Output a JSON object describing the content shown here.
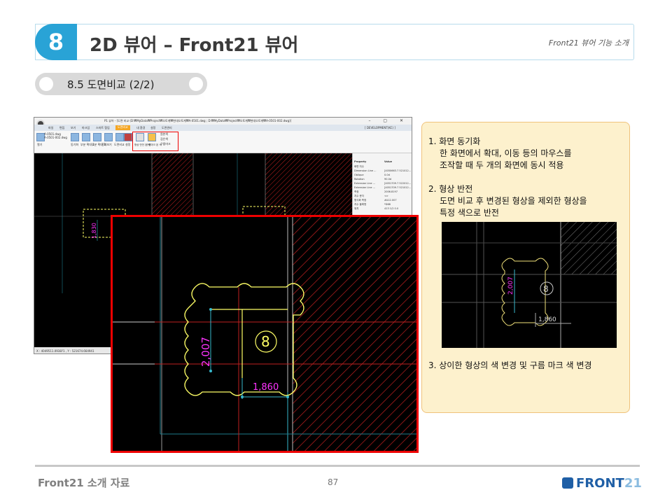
{
  "header": {
    "number": "8",
    "title": "2D 뷰어 – Front21 뷰어",
    "subtitle": "Front21 뷰어 기능 소개"
  },
  "section": {
    "title": "8.5 도면비교 (2/2)"
  },
  "app": {
    "window_title": "P1 뷰어 - [도면 비교 (D:₩MyData₩Project₩오토계₩현대오토계₩A-0501.dwg ; D:₩MyData₩Project₩오토계₩현대오토계₩A-0501-002.dwg)]",
    "window_buttons": "–  ▢  ✕",
    "menu": [
      "파일",
      "편집",
      "보기",
      "마크업",
      "스마트 협업",
      "도면비교",
      "내 환경",
      "설정",
      "도면관리"
    ],
    "active_menu_index": 5,
    "dev_label": "[ DEVELOPMENT(KC) ]",
    "files": [
      "A-0501.dwg",
      "A-0501-002.dwg"
    ],
    "ribbon_buttons": [
      "열기",
      "동기화",
      "부분 확대 1",
      "부분 확대 2",
      "전체보기",
      "도면비교",
      "설정"
    ],
    "ribbon_highlight_buttons": [
      "형상 반전 된 색",
      "구름마크 된 색"
    ],
    "ribbon_side_items": [
      "원본색",
      "검은색",
      "구름마크"
    ],
    "property_header": [
      "Property",
      "Value"
    ],
    "properties": [
      [
        "화면 치수",
        ""
      ],
      [
        "Dimension Line ...",
        "[4050663.7 521012..."
      ],
      [
        "Oblique",
        "0.0d"
      ],
      [
        "Rotation",
        "90.0d"
      ],
      [
        "Extension Line ...",
        "[4051709.7 522012..."
      ],
      [
        "Extension Line ...",
        "[4051709.7 521012..."
      ],
      [
        "측정",
        "2006.8197"
      ],
      [
        "치수 문자",
        "<>"
      ],
      [
        "형식화 측정",
        "#A12.007"
      ],
      [
        "치수 블록명",
        "*D68"
      ],
      [
        "위치",
        "413 1/2 0.0"
      ]
    ],
    "status": "X : 4049511.0938?1 , Y : 521674.664941"
  },
  "drawing": {
    "dim_vertical_small": "1,830",
    "dim_vertical": "2,007",
    "dim_horizontal": "1,860",
    "marker": "8"
  },
  "notes": {
    "n1_title": "1.  화면 동기화",
    "n1_line1": "한 화면에서 확대, 이동 등의 마우스를",
    "n1_line2": "조작할 때 두 개의 화면에 동시 적용",
    "n2_title": "2.  형상 반전",
    "n2_line1": "도면 비교 후 변경된 형상을 제외한 형상을",
    "n2_line2": "특정 색으로 반전",
    "n3": "3. 상이한 형상의 색 변경 및 구름 마크 색 변경"
  },
  "footer": {
    "left": "Front21 소개 자료",
    "page": "87",
    "logo_main": "FRONT",
    "logo_num": "21"
  },
  "colors": {
    "accent": "#29a3d6",
    "highlight": "#e00000",
    "note_bg": "#fdf1cd",
    "cad_yellow": "#ffff66",
    "cad_cyan": "#37b8cc",
    "cad_magenta": "#ff33ff",
    "cad_red": "#e02020"
  }
}
